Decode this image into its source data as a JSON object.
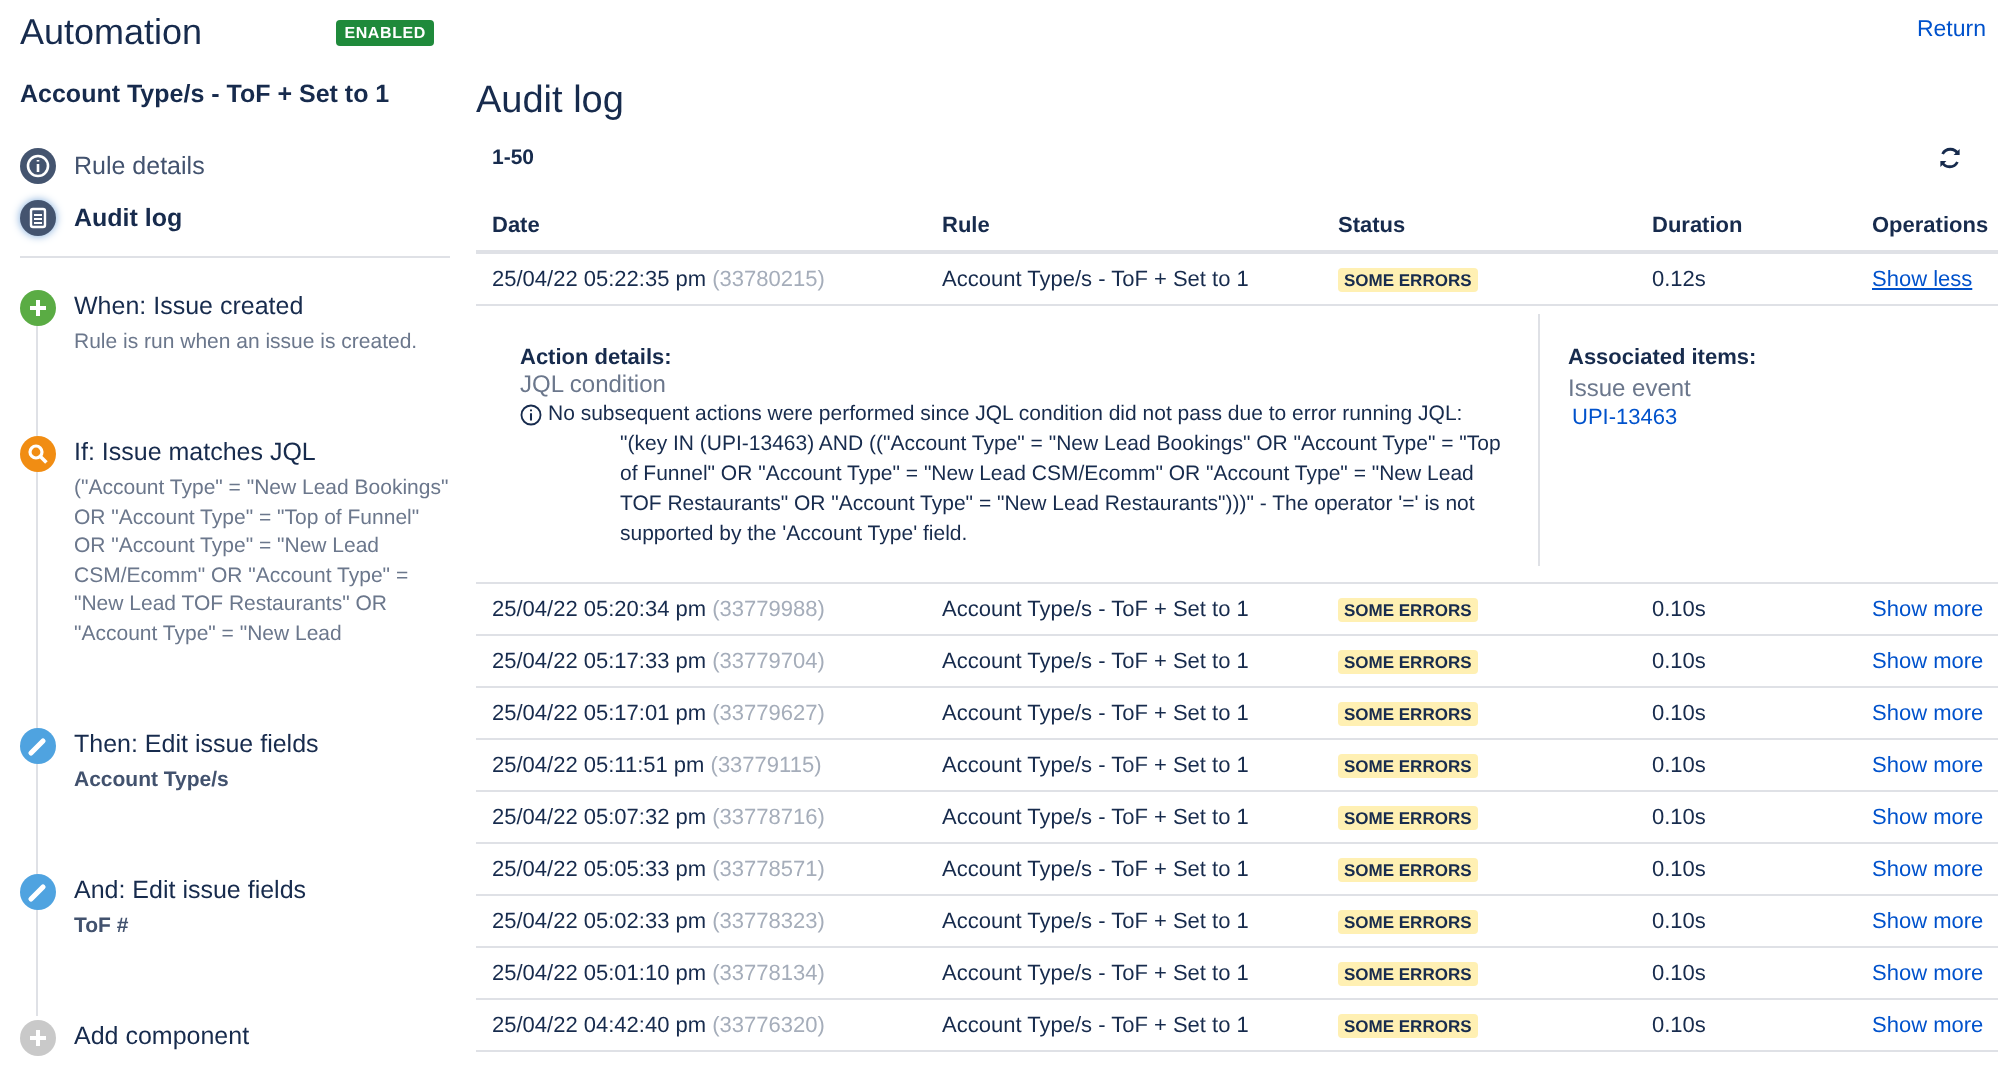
{
  "header": {
    "title": "Automation",
    "status_badge": "ENABLED"
  },
  "rule_name": "Account Type/s - ToF + Set to 1",
  "nav": [
    {
      "label": "Rule details",
      "kind": "info",
      "selected": false
    },
    {
      "label": "Audit log",
      "kind": "log",
      "selected": true
    }
  ],
  "components": [
    {
      "kind": "trigger",
      "title": "When: Issue created",
      "detail": "Rule is run when an issue is created."
    },
    {
      "kind": "condition",
      "title": "If: Issue matches JQL",
      "detail": "(\"Account Type\" = \"New Lead Bookings\" OR \"Account Type\" = \"Top of Funnel\" OR \"Account Type\" = \"New Lead CSM/Ecomm\" OR \"Account Type\" = \"New Lead TOF Restaurants\" OR \"Account Type\" = \"New Lead"
    },
    {
      "kind": "action",
      "title": "Then: Edit issue fields",
      "detail": "Account Type/s"
    },
    {
      "kind": "action",
      "title": "And: Edit issue fields",
      "detail": "ToF #"
    },
    {
      "kind": "add",
      "title": "Add component"
    }
  ],
  "return_link": "Return",
  "audit": {
    "title": "Audit log",
    "range": "1-50",
    "columns": [
      "Date",
      "Rule",
      "Status",
      "Duration",
      "Operations"
    ],
    "rows": [
      {
        "date": "25/04/22 05:22:35 pm",
        "id": "(33780215)",
        "rule": "Account Type/s - ToF + Set to 1",
        "status": "SOME ERRORS",
        "duration": "0.12s",
        "operation": "Show less",
        "expanded": true,
        "details": {
          "action_label": "Action details:",
          "action_name": "JQL condition",
          "message": "No subsequent actions were performed since JQL condition did not pass due to error running JQL:",
          "query": "\"(key IN (UPI-13463) AND ((\"Account Type\" = \"New Lead Bookings\" OR \"Account Type\" = \"Top of Funnel\" OR \"Account Type\" = \"New Lead CSM/Ecomm\" OR \"Account Type\" = \"New Lead TOF Restaurants\" OR \"Account Type\" = \"New Lead Restaurants\")))\" - The operator '=' is not supported by the 'Account Type' field.",
          "associated_label": "Associated items:",
          "associated_kind": "Issue event",
          "associated_link": "UPI-13463"
        }
      },
      {
        "date": "25/04/22 05:20:34 pm",
        "id": "(33779988)",
        "rule": "Account Type/s - ToF + Set to 1",
        "status": "SOME ERRORS",
        "duration": "0.10s",
        "operation": "Show more",
        "expanded": false
      },
      {
        "date": "25/04/22 05:17:33 pm",
        "id": "(33779704)",
        "rule": "Account Type/s - ToF + Set to 1",
        "status": "SOME ERRORS",
        "duration": "0.10s",
        "operation": "Show more",
        "expanded": false
      },
      {
        "date": "25/04/22 05:17:01 pm",
        "id": "(33779627)",
        "rule": "Account Type/s - ToF + Set to 1",
        "status": "SOME ERRORS",
        "duration": "0.10s",
        "operation": "Show more",
        "expanded": false
      },
      {
        "date": "25/04/22 05:11:51 pm",
        "id": "(33779115)",
        "rule": "Account Type/s - ToF + Set to 1",
        "status": "SOME ERRORS",
        "duration": "0.10s",
        "operation": "Show more",
        "expanded": false
      },
      {
        "date": "25/04/22 05:07:32 pm",
        "id": "(33778716)",
        "rule": "Account Type/s - ToF + Set to 1",
        "status": "SOME ERRORS",
        "duration": "0.10s",
        "operation": "Show more",
        "expanded": false
      },
      {
        "date": "25/04/22 05:05:33 pm",
        "id": "(33778571)",
        "rule": "Account Type/s - ToF + Set to 1",
        "status": "SOME ERRORS",
        "duration": "0.10s",
        "operation": "Show more",
        "expanded": false
      },
      {
        "date": "25/04/22 05:02:33 pm",
        "id": "(33778323)",
        "rule": "Account Type/s - ToF + Set to 1",
        "status": "SOME ERRORS",
        "duration": "0.10s",
        "operation": "Show more",
        "expanded": false
      },
      {
        "date": "25/04/22 05:01:10 pm",
        "id": "(33778134)",
        "rule": "Account Type/s - ToF + Set to 1",
        "status": "SOME ERRORS",
        "duration": "0.10s",
        "operation": "Show more",
        "expanded": false
      },
      {
        "date": "25/04/22 04:42:40 pm",
        "id": "(33776320)",
        "rule": "Account Type/s - ToF + Set to 1",
        "status": "SOME ERRORS",
        "duration": "0.10s",
        "operation": "Show more",
        "expanded": false
      }
    ]
  }
}
